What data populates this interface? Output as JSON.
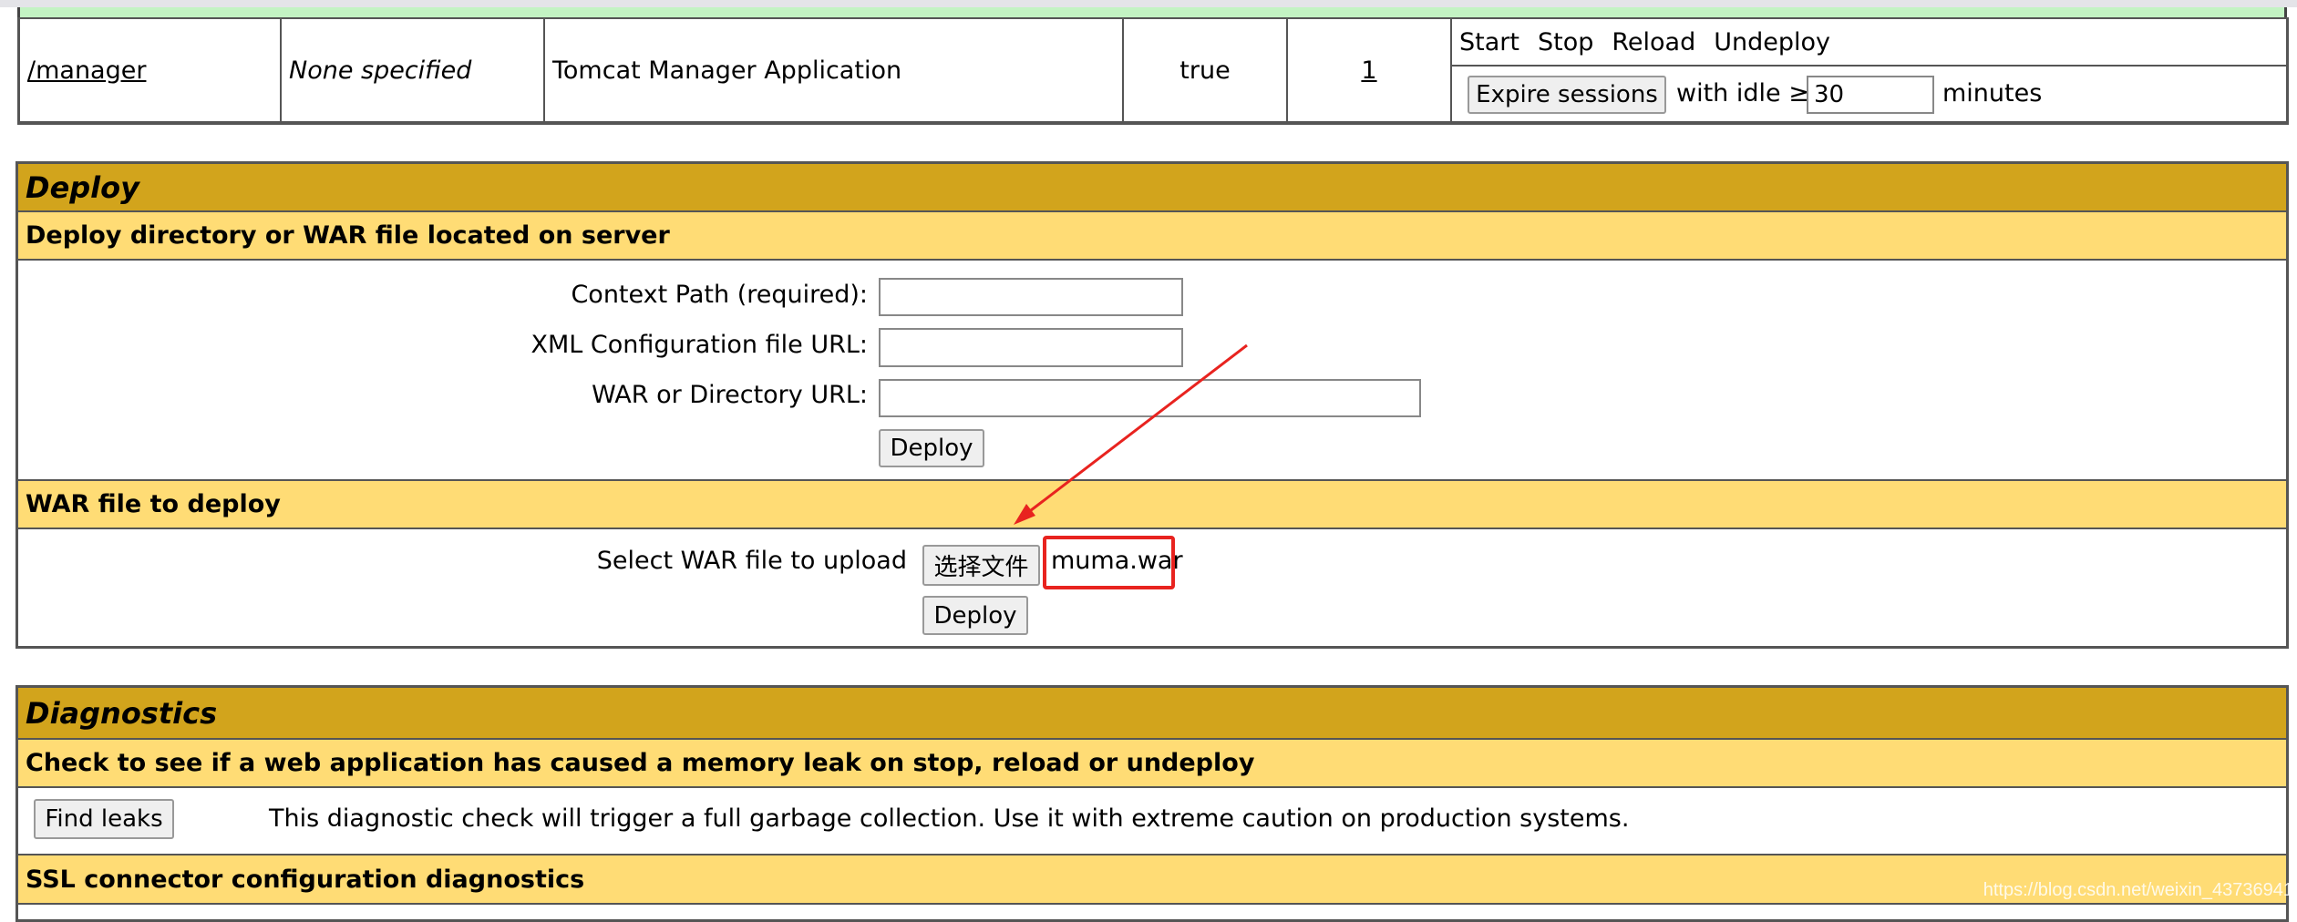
{
  "app_row": {
    "path": "/manager",
    "version": "None specified",
    "display_name": "Tomcat Manager Application",
    "running": "true",
    "sessions": "1",
    "commands": [
      "Start",
      "Stop",
      "Reload",
      "Undeploy"
    ],
    "expire_button": "Expire sessions",
    "with_idle": "with idle ≥",
    "idle_value": "30",
    "minutes": "minutes"
  },
  "deploy": {
    "title": "Deploy",
    "server_section": "Deploy directory or WAR file located on server",
    "context_label": "Context Path (required):",
    "xml_label": "XML Configuration file URL:",
    "war_url_label": "WAR or Directory URL:",
    "deploy_button": "Deploy",
    "upload_section": "WAR file to deploy",
    "select_label": "Select WAR file to upload",
    "choose_file_button": "选择文件",
    "chosen_file": "muma.war",
    "upload_deploy_button": "Deploy",
    "annotation_color": "#e8231f"
  },
  "diagnostics": {
    "title": "Diagnostics",
    "leak_section": "Check to see if a web application has caused a memory leak on stop, reload or undeploy",
    "find_leaks_button": "Find leaks",
    "leak_description": "This diagnostic check will trigger a full garbage collection. Use it with extreme caution on production systems.",
    "ssl_section": "SSL connector configuration diagnostics"
  },
  "watermark": "https://blog.csdn.net/weixin_43736941"
}
